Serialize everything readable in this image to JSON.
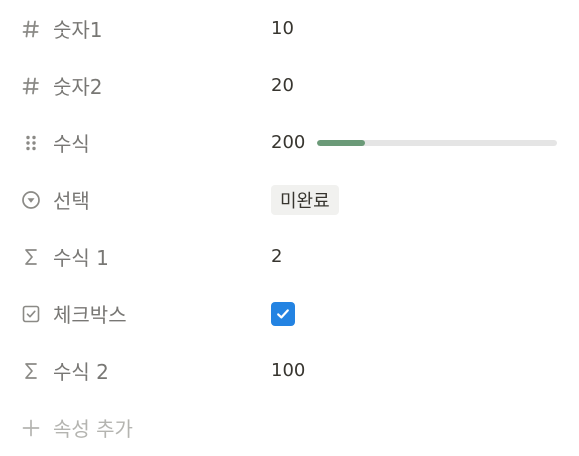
{
  "properties": [
    {
      "icon": "hash-icon",
      "name": "숫자1",
      "value": "10"
    },
    {
      "icon": "hash-icon",
      "name": "숫자2",
      "value": "20"
    },
    {
      "icon": "drag-dots-icon",
      "name": "수식",
      "value": "200",
      "progress": 0.2,
      "progress_color": "#6b9a78"
    },
    {
      "icon": "select-icon",
      "name": "선택",
      "value": "미완료"
    },
    {
      "icon": "sigma-icon",
      "name": "수식 1",
      "value": "2"
    },
    {
      "icon": "checkbox-icon",
      "name": "체크박스",
      "checked": true,
      "check_color": "#2383e2"
    },
    {
      "icon": "sigma-icon",
      "name": "수식 2",
      "value": "100"
    }
  ],
  "add_property": {
    "icon": "plus-icon",
    "label": "속성 추가"
  }
}
